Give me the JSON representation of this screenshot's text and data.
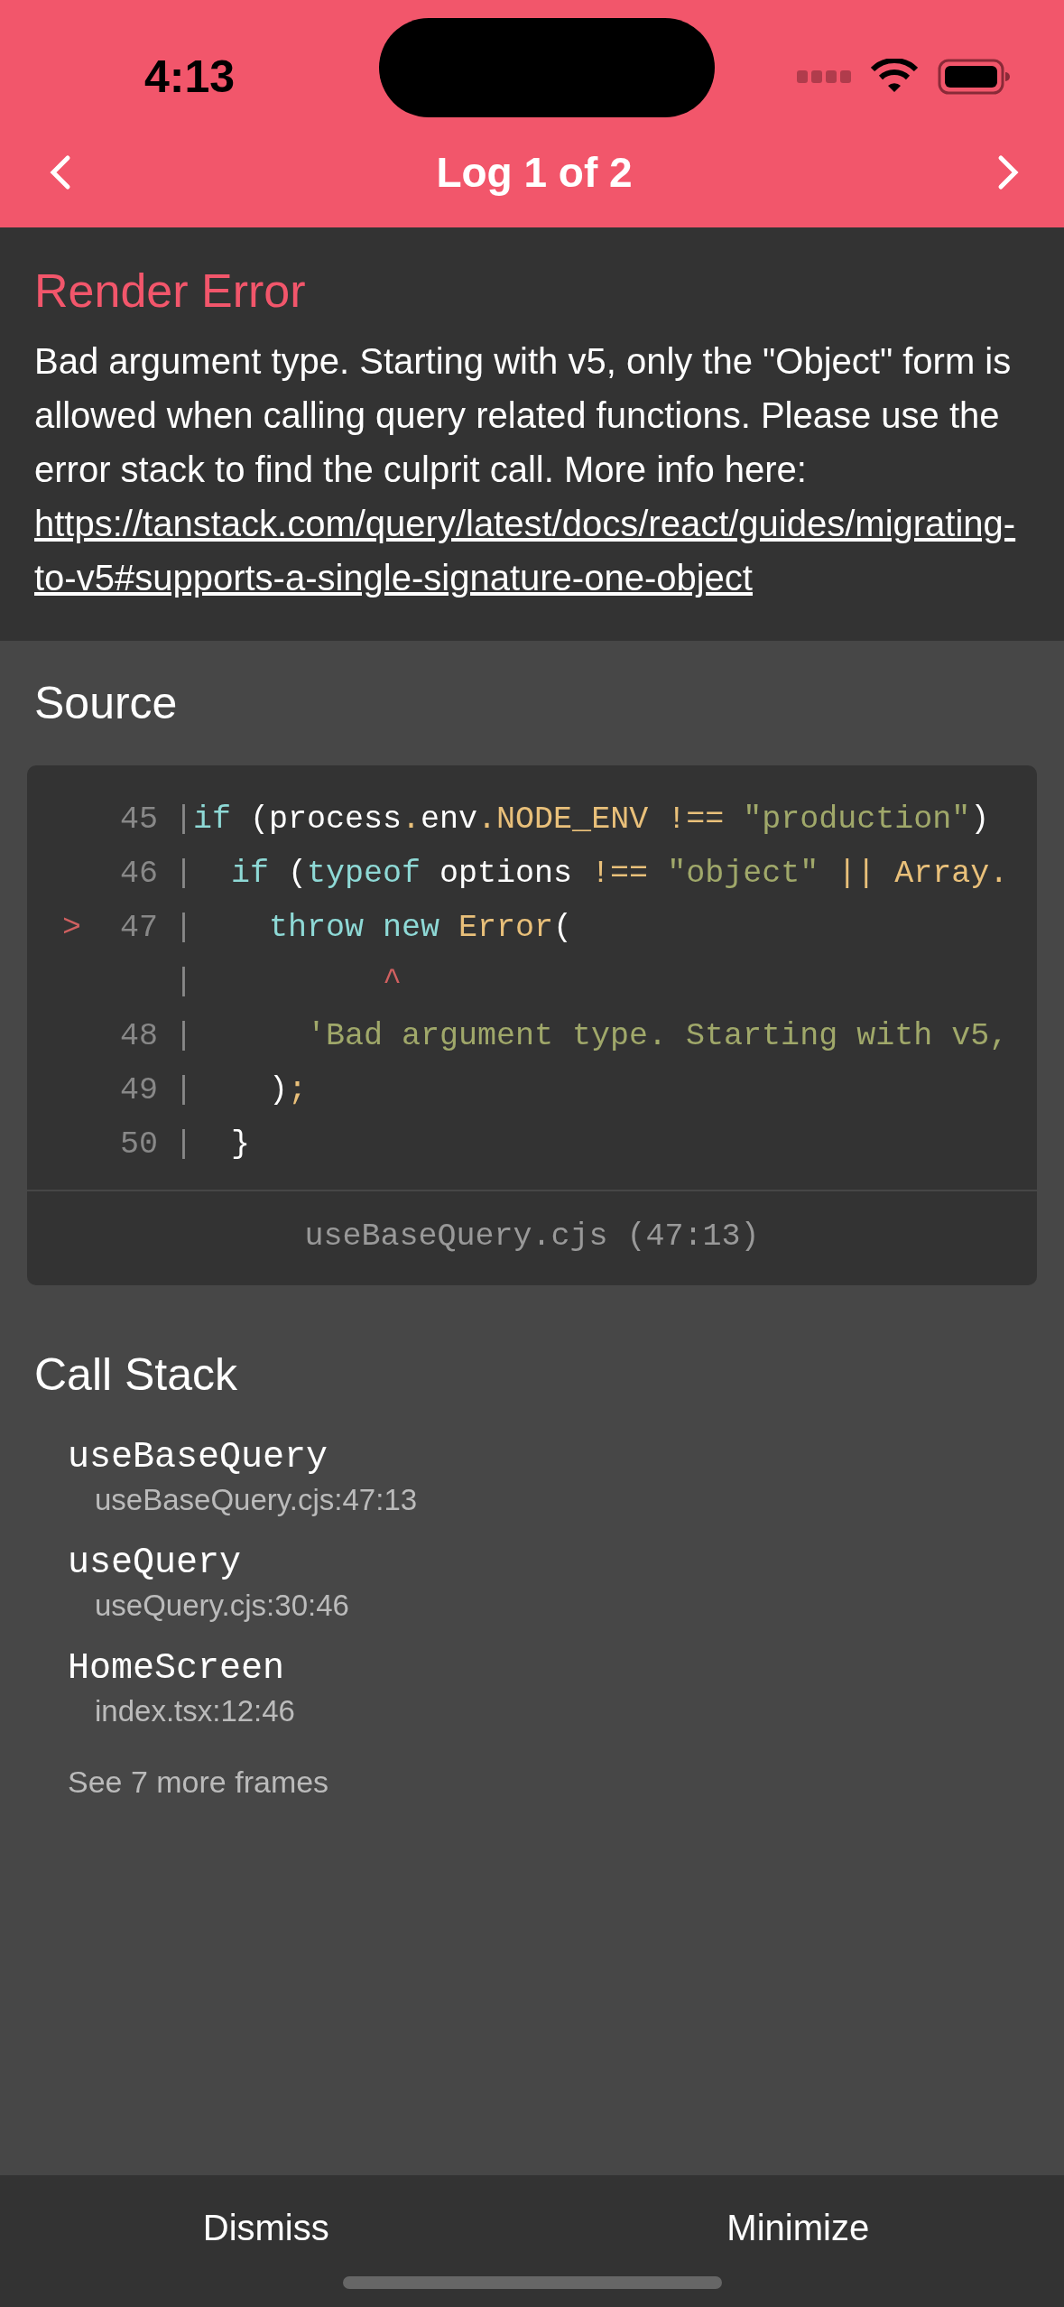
{
  "status_bar": {
    "time": "4:13"
  },
  "header": {
    "title": "Log 1 of 2"
  },
  "error": {
    "title": "Render Error",
    "message": "Bad argument type. Starting with v5, only the \"Object\" form is allowed when calling query related functions. Please use the error stack to find the culprit call. More info here: ",
    "link": "https://tanstack.com/query/latest/docs/react/guides/migrating-to-v5#supports-a-single-signature-one-object"
  },
  "source": {
    "heading": "Source",
    "file": "useBaseQuery.cjs (47:13)",
    "lines": [
      {
        "number": "45",
        "gutter": "|",
        "tokens": [
          {
            "kind": "keyword",
            "text": "if"
          },
          {
            "kind": "plain",
            "text": " (process"
          },
          {
            "kind": "accent",
            "text": "."
          },
          {
            "kind": "plain",
            "text": "env"
          },
          {
            "kind": "accent",
            "text": "."
          },
          {
            "kind": "accent",
            "text": "NODE_ENV !=="
          },
          {
            "kind": "string",
            "text": " \"production\""
          },
          {
            "kind": "plain",
            "text": ")"
          }
        ]
      },
      {
        "number": "46",
        "gutter": "|",
        "tokens": [
          {
            "kind": "keyword",
            "text": "  if"
          },
          {
            "kind": "plain",
            "text": " ("
          },
          {
            "kind": "keyword",
            "text": "typeof"
          },
          {
            "kind": "plain",
            "text": " options "
          },
          {
            "kind": "accent",
            "text": "!=="
          },
          {
            "kind": "string",
            "text": " \"object\""
          },
          {
            "kind": "accent",
            "text": " || Array."
          }
        ]
      },
      {
        "marker": ">",
        "number": "47",
        "gutter": "|",
        "tokens": [
          {
            "kind": "keyword",
            "text": "    throw new"
          },
          {
            "kind": "accent",
            "text": " Error"
          },
          {
            "kind": "plain",
            "text": "("
          }
        ]
      },
      {
        "gutter": "|",
        "tokens": [
          {
            "kind": "error",
            "text": "          ^"
          }
        ]
      },
      {
        "number": "48",
        "gutter": "|",
        "tokens": [
          {
            "kind": "string",
            "text": "      'Bad argument type. Starting with v5,"
          }
        ]
      },
      {
        "number": "49",
        "gutter": "|",
        "tokens": [
          {
            "kind": "plain",
            "text": "    )"
          },
          {
            "kind": "accent",
            "text": ";"
          }
        ]
      },
      {
        "number": "50",
        "gutter": "|",
        "tokens": [
          {
            "kind": "plain",
            "text": "  }"
          }
        ]
      }
    ]
  },
  "call_stack": {
    "heading": "Call Stack",
    "frames": [
      {
        "name": "useBaseQuery",
        "location": "useBaseQuery.cjs:47:13"
      },
      {
        "name": "useQuery",
        "location": "useQuery.cjs:30:46"
      },
      {
        "name": "HomeScreen",
        "location": "index.tsx:12:46"
      }
    ],
    "more": "See 7 more frames"
  },
  "footer": {
    "buttons": [
      "Dismiss",
      "Minimize"
    ]
  }
}
